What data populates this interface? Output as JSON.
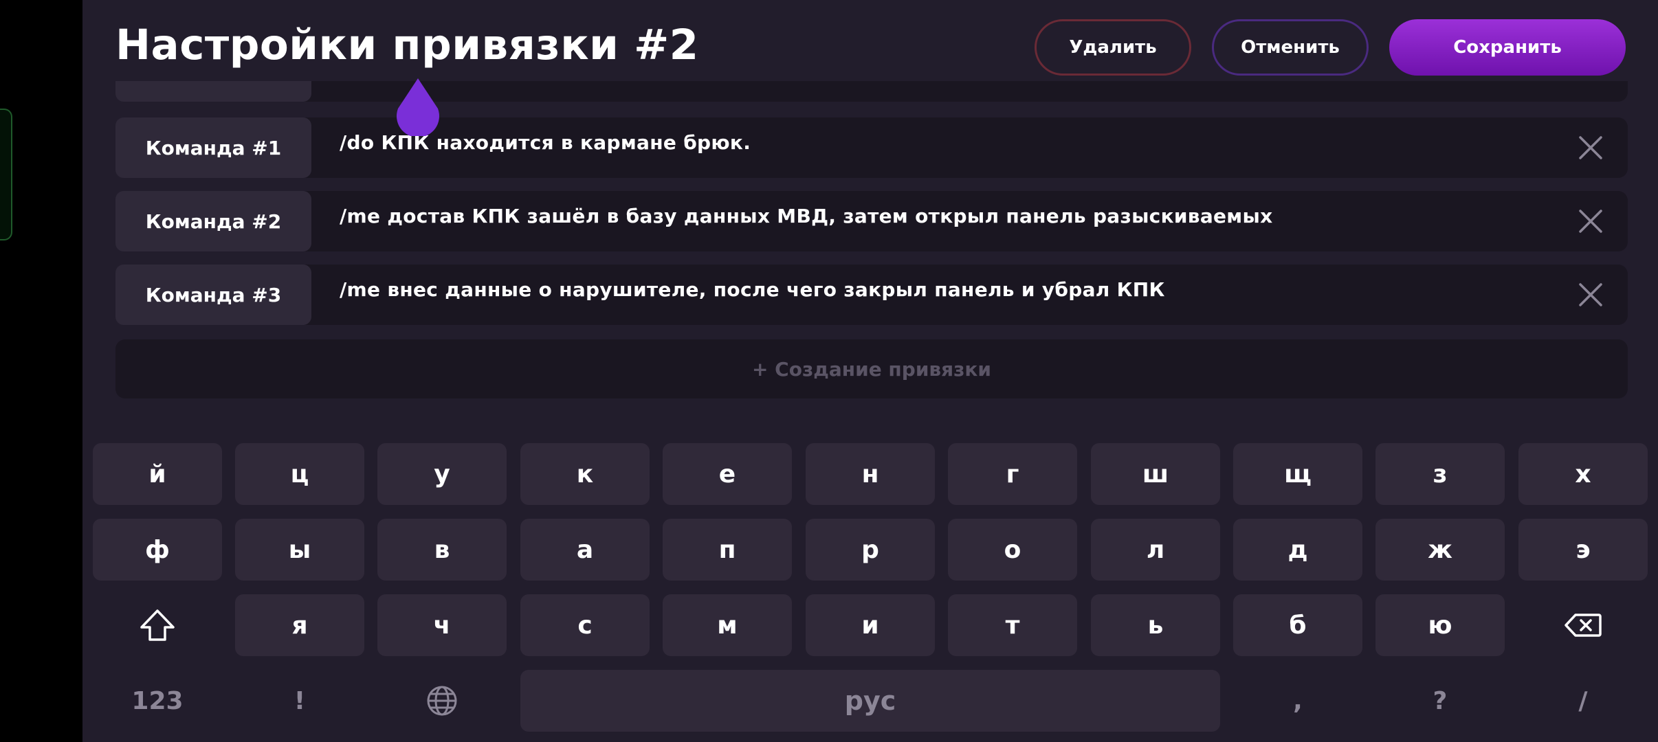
{
  "header": {
    "title": "Настройки привязки #2",
    "delete_label": "Удалить",
    "cancel_label": "Отменить",
    "save_label": "Сохранить"
  },
  "commands": [
    {
      "label": "Команда #1",
      "text": "/do КПК находится в кармане брюк."
    },
    {
      "label": "Команда #2",
      "text": "/me достав КПК зашёл в базу данных МВД, затем открыл панель разыскиваемых"
    },
    {
      "label": "Команда #3",
      "text": "/me внес данные о нарушителе, после чего закрыл панель и убрал КПК"
    }
  ],
  "create_binding_label": "+ Создание привязки",
  "keyboard": {
    "row1": [
      "й",
      "ц",
      "у",
      "к",
      "е",
      "н",
      "г",
      "ш",
      "щ",
      "з",
      "х"
    ],
    "row2": [
      "ф",
      "ы",
      "в",
      "а",
      "п",
      "р",
      "о",
      "л",
      "д",
      "ж",
      "э"
    ],
    "row3": [
      "я",
      "ч",
      "с",
      "м",
      "и",
      "т",
      "ь",
      "б",
      "ю"
    ],
    "numbers_label": "123",
    "exclamation_label": "!",
    "space_label": "рус",
    "comma_label": ",",
    "question_label": "?",
    "slash_label": "/",
    "shift_icon": "shift-icon",
    "backspace_icon": "backspace-icon",
    "language_icon": "globe-icon"
  },
  "colors": {
    "panel_bg": "#221d2c",
    "row_bg": "#1a1621",
    "key_bg": "#302939",
    "accent": "#8a2be2",
    "delete_border": "#6a2a36",
    "cancel_border": "#4a2a80"
  }
}
